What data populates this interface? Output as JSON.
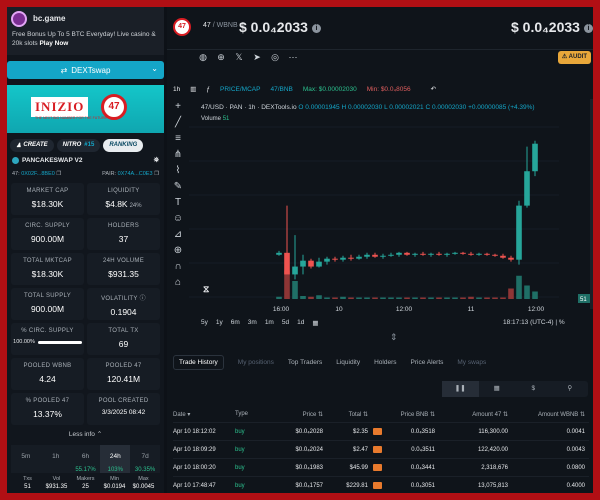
{
  "ad": {
    "brand": "bc.game",
    "line1": "Free Bonus Up To 5 BTC Everyday! Live casino & 20k slots",
    "cta": "Play Now"
  },
  "dex_button": "DEXTswap",
  "banner": {
    "brand": "INIZIO",
    "number": "47",
    "sub": "THE NEXT BIG NUMBER FOR THE FUTURE"
  },
  "token_bar": {
    "create": "CREATE",
    "nitro": "NITRO",
    "nitro_num": "#15",
    "ranking": "RANKING"
  },
  "pair": {
    "exchange": "PANCAKESWAP V2",
    "addr_label": "47:",
    "addr": "0X02F...8BE0",
    "pair_label": "PAIR:",
    "pair_addr": "0X74A...C0E3"
  },
  "stats": [
    {
      "label": "MARKET CAP",
      "value": "$18.30K"
    },
    {
      "label": "LIQUIDITY",
      "value": "$4.8K",
      "extra": "24%"
    },
    {
      "label": "CIRC. SUPPLY",
      "value": "900.00M"
    },
    {
      "label": "HOLDERS",
      "value": "37"
    },
    {
      "label": "TOTAL MKTCAP",
      "value": "$18.30K"
    },
    {
      "label": "24H VOLUME",
      "value": "$931.35"
    },
    {
      "label": "TOTAL SUPPLY",
      "value": "900.00M"
    },
    {
      "label": "VOLATILITY",
      "value": "0.1904"
    },
    {
      "label": "% CIRC. SUPPLY",
      "value": "100.00%",
      "fill_pct": 100
    },
    {
      "label": "TOTAL TX",
      "value": "69"
    },
    {
      "label": "POOLED WBNB",
      "value": "4.24"
    },
    {
      "label": "POOLED 47",
      "value": "120.41M"
    },
    {
      "label": "% POOLED 47",
      "value": "13.37%"
    },
    {
      "label": "POOL CREATED",
      "value": "3/3/2025 08:42"
    }
  ],
  "less_info": "Less info",
  "periods": [
    {
      "label": "5m",
      "change": ""
    },
    {
      "label": "1h",
      "change": ""
    },
    {
      "label": "6h",
      "change": "55.17%"
    },
    {
      "label": "24h",
      "change": "103%",
      "active": true
    },
    {
      "label": "7d",
      "change": "30.35%"
    }
  ],
  "txstats": [
    {
      "label": "Txs",
      "value": "51"
    },
    {
      "label": "Vol",
      "value": "$931.35"
    },
    {
      "label": "Makers",
      "value": "25"
    },
    {
      "label": "Min",
      "value": "$0.0194"
    },
    {
      "label": "Max",
      "value": "$0.0045"
    }
  ],
  "header": {
    "token_badge": "47",
    "pair": "47",
    "quote": "/ WBNB",
    "price": "$ 0.0₄2033",
    "price_right": "$ 0.0₄2033",
    "audit": "AUDIT"
  },
  "chart_tools": {
    "interval": "1h",
    "price_mcap": "PRICE/MCAP",
    "pair": "47/BNB",
    "max": "Max: $0.00002030",
    "min": "Min: $0.0₄8056"
  },
  "legend": {
    "title": "47/USD · PAN · 1h · DEXTools.io",
    "o": "O 0.00001945",
    "h": "H 0.00002030",
    "l": "L 0.00002021",
    "c": "C 0.00002030",
    "chg": "+0.00000085 (+4.39%)",
    "volume_label": "Volume",
    "volume": "51"
  },
  "chart_data": {
    "type": "candlestick",
    "title": "47/USD · PAN · 1h · DEXTools.io",
    "x_ticks": [
      "16:00",
      "10",
      "12:00",
      "11",
      "12:00"
    ],
    "candles": [
      {
        "o": 9e-06,
        "h": 9.4e-06,
        "l": 8.9e-06,
        "c": 9.2e-06,
        "v": 3
      },
      {
        "o": 9.2e-06,
        "h": 1.4e-05,
        "l": 8e-06,
        "c": 7e-06,
        "v": 38
      },
      {
        "o": 7e-06,
        "h": 1.1e-05,
        "l": 6.5e-06,
        "c": 7.8e-06,
        "v": 24
      },
      {
        "o": 7.8e-06,
        "h": 9e-06,
        "l": 7e-06,
        "c": 8.4e-06,
        "v": 4
      },
      {
        "o": 8.4e-06,
        "h": 8.6e-06,
        "l": 7.6e-06,
        "c": 7.8e-06,
        "v": 3
      },
      {
        "o": 7.8e-06,
        "h": 8.7e-06,
        "l": 7.7e-06,
        "c": 8.3e-06,
        "v": 5
      },
      {
        "o": 8.3e-06,
        "h": 8.8e-06,
        "l": 8e-06,
        "c": 8.6e-06,
        "v": 2
      },
      {
        "o": 8.6e-06,
        "h": 8.8e-06,
        "l": 8.3e-06,
        "c": 8.5e-06,
        "v": 2
      },
      {
        "o": 8.5e-06,
        "h": 8.9e-06,
        "l": 8.3e-06,
        "c": 8.7e-06,
        "v": 3
      },
      {
        "o": 8.7e-06,
        "h": 9e-06,
        "l": 8.4e-06,
        "c": 8.6e-06,
        "v": 2
      },
      {
        "o": 8.6e-06,
        "h": 9e-06,
        "l": 8.5e-06,
        "c": 8.8e-06,
        "v": 2
      },
      {
        "o": 8.8e-06,
        "h": 9.2e-06,
        "l": 8.6e-06,
        "c": 9e-06,
        "v": 2
      },
      {
        "o": 9e-06,
        "h": 9.2e-06,
        "l": 8.7e-06,
        "c": 8.8e-06,
        "v": 2
      },
      {
        "o": 8.8e-06,
        "h": 9.1e-06,
        "l": 8.6e-06,
        "c": 8.9e-06,
        "v": 2
      },
      {
        "o": 8.9e-06,
        "h": 9.2e-06,
        "l": 8.8e-06,
        "c": 9e-06,
        "v": 2
      },
      {
        "o": 9e-06,
        "h": 9.3e-06,
        "l": 8.8e-06,
        "c": 9.2e-06,
        "v": 2
      },
      {
        "o": 9.2e-06,
        "h": 9.3e-06,
        "l": 8.9e-06,
        "c": 9e-06,
        "v": 2
      },
      {
        "o": 9e-06,
        "h": 9.2e-06,
        "l": 8.8e-06,
        "c": 9.1e-06,
        "v": 2
      },
      {
        "o": 9.1e-06,
        "h": 9.3e-06,
        "l": 8.9e-06,
        "c": 9e-06,
        "v": 2
      },
      {
        "o": 9e-06,
        "h": 9.2e-06,
        "l": 8.8e-06,
        "c": 9.1e-06,
        "v": 2
      },
      {
        "o": 9.1e-06,
        "h": 9.3e-06,
        "l": 8.9e-06,
        "c": 9e-06,
        "v": 2
      },
      {
        "o": 9e-06,
        "h": 9.2e-06,
        "l": 8.8e-06,
        "c": 9.1e-06,
        "v": 2
      },
      {
        "o": 9.1e-06,
        "h": 9.3e-06,
        "l": 9e-06,
        "c": 9.2e-06,
        "v": 2
      },
      {
        "o": 9.2e-06,
        "h": 9.3e-06,
        "l": 9e-06,
        "c": 9.1e-06,
        "v": 2
      },
      {
        "o": 9.1e-06,
        "h": 9.3e-06,
        "l": 8.9e-06,
        "c": 9e-06,
        "v": 3
      },
      {
        "o": 9e-06,
        "h": 9.2e-06,
        "l": 8.9e-06,
        "c": 9.1e-06,
        "v": 2
      },
      {
        "o": 9.1e-06,
        "h": 9.2e-06,
        "l": 8.9e-06,
        "c": 9e-06,
        "v": 2
      },
      {
        "o": 9e-06,
        "h": 9.1e-06,
        "l": 8.8e-06,
        "c": 8.9e-06,
        "v": 2
      },
      {
        "o": 8.9e-06,
        "h": 9.1e-06,
        "l": 8.6e-06,
        "c": 8.7e-06,
        "v": 2
      },
      {
        "o": 8.7e-06,
        "h": 8.9e-06,
        "l": 8.3e-06,
        "c": 8.5e-06,
        "v": 14
      },
      {
        "o": 8.5e-06,
        "h": 1.45e-05,
        "l": 8e-06,
        "c": 1.4e-05,
        "v": 31
      },
      {
        "o": 1.4e-05,
        "h": 2e-05,
        "l": 1.38e-05,
        "c": 1.75e-05,
        "v": 18
      },
      {
        "o": 1.75e-05,
        "h": 2.06e-05,
        "l": 1.7e-05,
        "c": 2.03e-05,
        "v": 10
      }
    ],
    "price_range": [
      4.5e-06,
      2.2e-05
    ],
    "volume_range": [
      0,
      80
    ]
  },
  "ranges": [
    "5y",
    "1y",
    "6m",
    "3m",
    "1m",
    "5d",
    "1d"
  ],
  "clock": "18:17:13 (UTC-4)",
  "tabs": [
    {
      "label": "Trade History",
      "state": "on"
    },
    {
      "label": "My positions",
      "state": "dim"
    },
    {
      "label": "Top Traders",
      "state": ""
    },
    {
      "label": "Liquidity",
      "state": ""
    },
    {
      "label": "Holders",
      "state": ""
    },
    {
      "label": "Price Alerts",
      "state": ""
    },
    {
      "label": "My swaps",
      "state": "dim"
    }
  ],
  "table": {
    "headers": [
      "Date",
      "Type",
      "Price",
      "Total",
      "",
      "Price BNB",
      "Amount 47",
      "Amount WBNB"
    ],
    "rows": [
      [
        "Apr 10 18:12:02",
        "buy",
        "$0.0₄2028",
        "$2.35",
        "",
        "0.0₄3518",
        "116,300.00",
        "0.0041"
      ],
      [
        "Apr 10 18:09:29",
        "buy",
        "$0.0₄2024",
        "$2.47",
        "",
        "0.0₄3511",
        "122,420.00",
        "0.0043"
      ],
      [
        "Apr 10 18:00:20",
        "buy",
        "$0.0₄1983",
        "$45.99",
        "",
        "0.0₄3441",
        "2,318,676",
        "0.0800"
      ],
      [
        "Apr 10 17:48:47",
        "buy",
        "$0.0₄1757",
        "$229.81",
        "",
        "0.0₄3051",
        "13,075,813",
        "0.4000"
      ]
    ]
  }
}
